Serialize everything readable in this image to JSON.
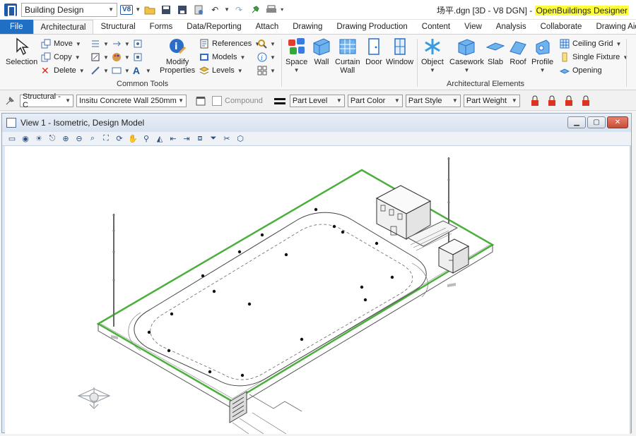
{
  "titlebar": {
    "workflow": "Building Design",
    "version_badge": "V8",
    "doc_title": "场平.dgn [3D - V8 DGN] - ",
    "product": "OpenBuildings Designer"
  },
  "tabs": [
    "File",
    "Architectural",
    "Structural",
    "Forms",
    "Data/Reporting",
    "Attach",
    "Drawing",
    "Drawing Production",
    "Content",
    "View",
    "Analysis",
    "Collaborate",
    "Drawing Aids"
  ],
  "active_tab": "Architectural",
  "common_tools": {
    "label": "Common Tools",
    "selection": "Selection",
    "move": "Move",
    "copy": "Copy",
    "delete": "Delete",
    "modify_properties_1": "Modify",
    "modify_properties_2": "Properties",
    "references": "References",
    "models": "Models",
    "levels": "Levels"
  },
  "arch_elements": {
    "label": "Architectural Elements",
    "space": "Space",
    "wall": "Wall",
    "curtain_wall_1": "Curtain",
    "curtain_wall_2": "Wall",
    "door": "Door",
    "window": "Window",
    "object": "Object",
    "casework": "Casework",
    "slab": "Slab",
    "roof": "Roof",
    "profile": "Profile",
    "ceiling_grid": "Ceiling Grid",
    "single_fixture": "Single Fixture",
    "opening": "Opening"
  },
  "attrbar": {
    "family": "Structural - C",
    "part": "Insitu Concrete Wall 250mm",
    "compound": "Compound",
    "part_level": "Part Level",
    "part_color": "Part Color",
    "part_style": "Part Style",
    "part_weight": "Part Weight"
  },
  "view": {
    "title": "View 1 - Isometric, Design Model"
  },
  "colors": {
    "file_tab": "#1f6fc5",
    "highlight": "#ffff3a",
    "slab_edge": "#4caf3d"
  }
}
